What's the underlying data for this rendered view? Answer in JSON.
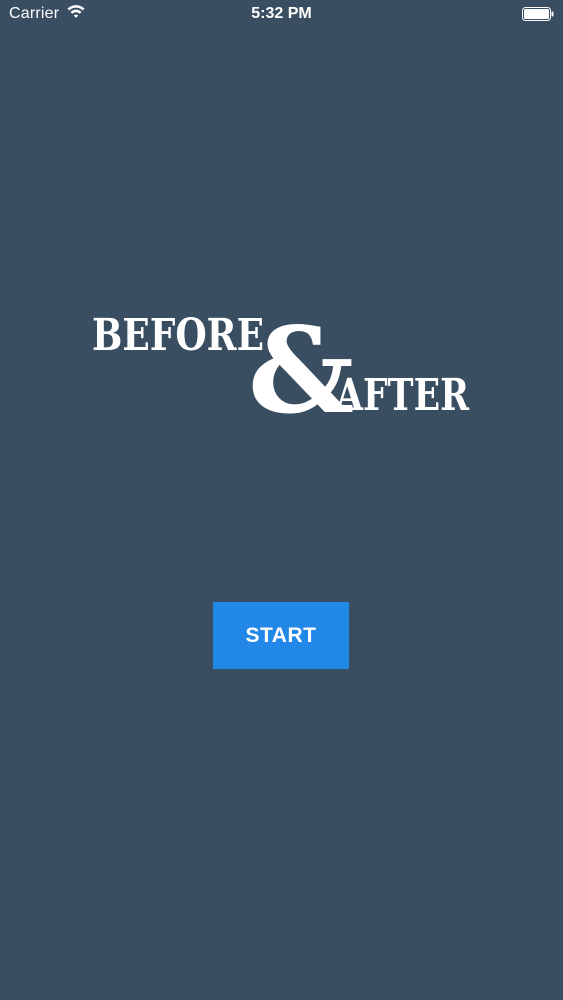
{
  "status_bar": {
    "carrier": "Carrier",
    "time": "5:32 PM",
    "wifi_icon": "wifi-icon",
    "battery_icon": "battery-icon"
  },
  "logo": {
    "word_before": "BEFORE",
    "ampersand": "&",
    "word_after": "AFTER",
    "color": "#ffffff"
  },
  "start_button": {
    "label": "START",
    "color": "#2288e8"
  },
  "colors": {
    "background": "#3a4e61",
    "text": "#ffffff"
  }
}
